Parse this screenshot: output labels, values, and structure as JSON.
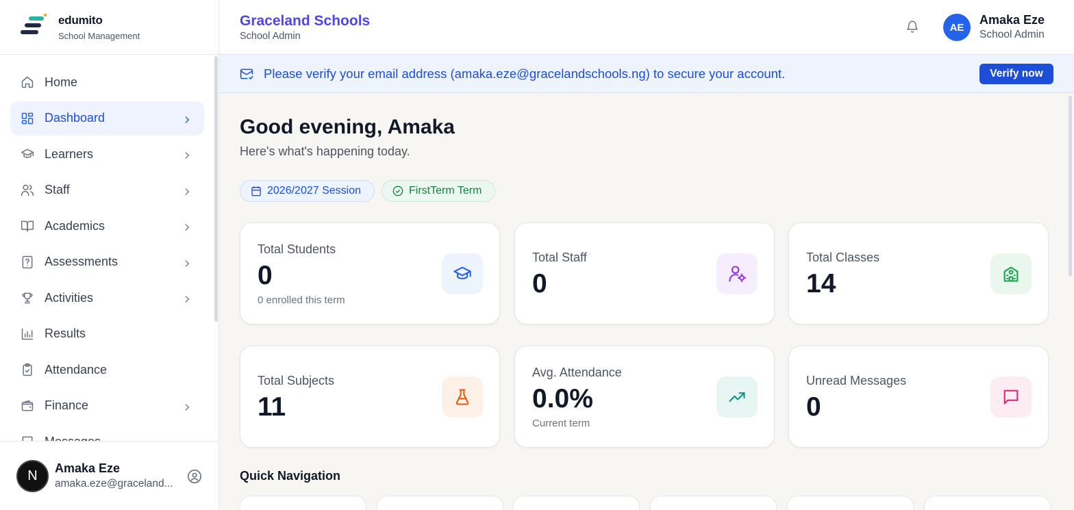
{
  "brand": {
    "name": "edumito",
    "subtitle": "School Management"
  },
  "sidebar": {
    "items": [
      {
        "label": "Home",
        "icon": "home-icon",
        "active": false,
        "has_children": false
      },
      {
        "label": "Dashboard",
        "icon": "dashboard-grid-icon",
        "active": true,
        "has_children": true
      },
      {
        "label": "Learners",
        "icon": "graduation-cap-icon",
        "active": false,
        "has_children": true
      },
      {
        "label": "Staff",
        "icon": "users-icon",
        "active": false,
        "has_children": true
      },
      {
        "label": "Academics",
        "icon": "book-open-icon",
        "active": false,
        "has_children": true
      },
      {
        "label": "Assessments",
        "icon": "file-question-icon",
        "active": false,
        "has_children": true
      },
      {
        "label": "Activities",
        "icon": "trophy-icon",
        "active": false,
        "has_children": true
      },
      {
        "label": "Results",
        "icon": "bar-chart-icon",
        "active": false,
        "has_children": false
      },
      {
        "label": "Attendance",
        "icon": "clipboard-check-icon",
        "active": false,
        "has_children": false
      },
      {
        "label": "Finance",
        "icon": "wallet-icon",
        "active": false,
        "has_children": true
      },
      {
        "label": "Messages",
        "icon": "message-icon",
        "active": false,
        "has_children": false
      }
    ],
    "user": {
      "initial": "N",
      "name": "Amaka Eze",
      "email": "amaka.eze@graceland..."
    }
  },
  "header": {
    "school_name": "Graceland Schools",
    "school_role": "School Admin",
    "avatar_initials": "AE",
    "user_name": "Amaka Eze",
    "user_role": "School Admin"
  },
  "banner": {
    "message": "Please verify your email address (amaka.eze@gracelandschools.ng) to secure your account.",
    "button": "Verify now"
  },
  "main": {
    "greeting": "Good evening, Amaka",
    "subtitle": "Here's what's happening today.",
    "session_label": "2026/2027 Session",
    "term_label": "FirstTerm Term",
    "quick_nav_title": "Quick Navigation"
  },
  "stats": [
    {
      "label": "Total Students",
      "value": "0",
      "note": "0 enrolled this term",
      "icon": "graduation-cap-icon",
      "color": "#2563eb",
      "bg": "#eef4fd"
    },
    {
      "label": "Total Staff",
      "value": "0",
      "note": "",
      "icon": "user-cog-icon",
      "color": "#9333ea",
      "bg": "#f6eefd"
    },
    {
      "label": "Total Classes",
      "value": "14",
      "note": "",
      "icon": "school-building-icon",
      "color": "#16a34a",
      "bg": "#e9f7ef"
    },
    {
      "label": "Total Subjects",
      "value": "11",
      "note": "",
      "icon": "flask-icon",
      "color": "#ea580c",
      "bg": "#fdf1e7"
    },
    {
      "label": "Avg. Attendance",
      "value": "0.0%",
      "note": "Current term",
      "icon": "trending-up-icon",
      "color": "#0d9488",
      "bg": "#e8f6f3"
    },
    {
      "label": "Unread Messages",
      "value": "0",
      "note": "",
      "icon": "chat-bubble-icon",
      "color": "#db2777",
      "bg": "#fdedf3"
    }
  ]
}
